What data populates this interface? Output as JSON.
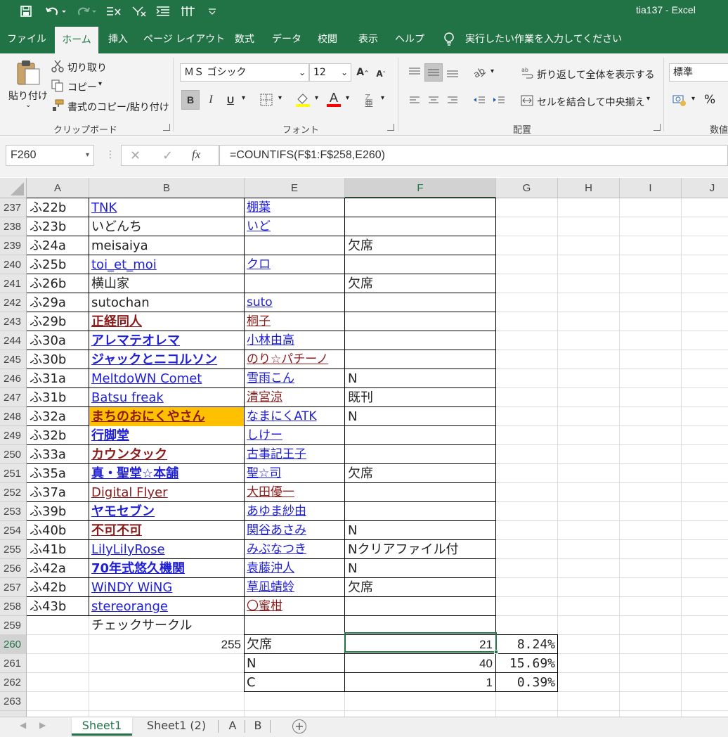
{
  "window": {
    "title": "tia137  -  Excel"
  },
  "ribbon_tabs": [
    "ファイル",
    "ホーム",
    "挿入",
    "ページ レイアウト",
    "数式",
    "データ",
    "校閲",
    "表示",
    "ヘルプ"
  ],
  "tell_me": "実行したい作業を入力してください",
  "clipboard": {
    "paste": "貼り付け",
    "cut": "切り取り",
    "copy": "コピー",
    "format_painter": "書式のコピー/貼り付け",
    "label": "クリップボード"
  },
  "font": {
    "name": "ＭＳ ゴシック",
    "size": "12",
    "label": "フォント",
    "bold": "B",
    "italic": "I",
    "underline": "U",
    "grow": "A",
    "shrink": "A",
    "color_a": "A"
  },
  "alignment": {
    "wrap": "折り返して全体を表示する",
    "merge": "セルを結合して中央揃え",
    "label": "配置"
  },
  "number": {
    "format": "標準",
    "label": "数値",
    "percent": "%"
  },
  "formula_bar": {
    "name_box": "F260",
    "fx": "fx",
    "formula": "=COUNTIFS(F$1:F$258,E260)"
  },
  "columns": [
    "A",
    "B",
    "E",
    "F",
    "G",
    "H",
    "I",
    "J"
  ],
  "rows": [
    {
      "num": "237",
      "a": "ふ22b",
      "b": "TNK",
      "e": "棚葉",
      "f": ""
    },
    {
      "num": "238",
      "a": "ふ23b",
      "b": "いどんち",
      "e": "いど",
      "f": ""
    },
    {
      "num": "239",
      "a": "ふ24a",
      "b": "meisaiya",
      "e": "",
      "f": "欠席"
    },
    {
      "num": "240",
      "a": "ふ25b",
      "b": "toi_et_moi",
      "e": "クロ",
      "f": ""
    },
    {
      "num": "241",
      "a": "ふ26b",
      "b": "横山家",
      "e": "",
      "f": "欠席"
    },
    {
      "num": "242",
      "a": "ふ29a",
      "b": "sutochan",
      "e": "suto",
      "f": ""
    },
    {
      "num": "243",
      "a": "ふ29b",
      "b": "正経同人",
      "e": "桐子",
      "f": ""
    },
    {
      "num": "244",
      "a": "ふ30a",
      "b": "アレマテオレマ",
      "e": "小林由高",
      "f": ""
    },
    {
      "num": "245",
      "a": "ふ30b",
      "b": "ジャックとニコルソン",
      "e": "のり☆パチーノ",
      "f": ""
    },
    {
      "num": "246",
      "a": "ふ31a",
      "b": "MeltdoWN Comet",
      "e": "雪雨こん",
      "f": "N"
    },
    {
      "num": "247",
      "a": "ふ31b",
      "b": "Batsu freak",
      "e": "清宮涼",
      "f": "既刊"
    },
    {
      "num": "248",
      "a": "ふ32a",
      "b": "まちのおにくやさん",
      "e": "なまにくATK",
      "f": "N"
    },
    {
      "num": "249",
      "a": "ふ32b",
      "b": "行脚堂",
      "e": "しけー",
      "f": ""
    },
    {
      "num": "250",
      "a": "ふ33a",
      "b": "カウンタック",
      "e": "古事記王子",
      "f": ""
    },
    {
      "num": "251",
      "a": "ふ35a",
      "b": "真・聖堂☆本舗",
      "e": "聖☆司",
      "f": "欠席"
    },
    {
      "num": "252",
      "a": "ふ37a",
      "b": "Digital Flyer",
      "e": "大田優一",
      "f": ""
    },
    {
      "num": "253",
      "a": "ふ39b",
      "b": "ヤモセブン",
      "e": "あゆま紗由",
      "f": ""
    },
    {
      "num": "254",
      "a": "ふ40b",
      "b": "不可不可",
      "e": "関谷あさみ",
      "f": "N"
    },
    {
      "num": "255",
      "a": "ふ41b",
      "b": "LilyLilyRose",
      "e": "みぶなつき",
      "f": "Nクリアファイル付"
    },
    {
      "num": "256",
      "a": "ふ42a",
      "b": "70年式悠久機関",
      "e": "袁藤沖人",
      "f": "N"
    },
    {
      "num": "257",
      "a": "ふ42b",
      "b": "WiNDY WiNG",
      "e": "草凪蜻蛉",
      "f": "欠席"
    },
    {
      "num": "258",
      "a": "ふ43b",
      "b": "stereorange",
      "e": "〇蜜柑",
      "f": ""
    },
    {
      "num": "259",
      "a": "",
      "b": "チェックサークル",
      "e": "",
      "f": ""
    },
    {
      "num": "260",
      "a": "",
      "b": "255",
      "e": "欠席",
      "f": "21",
      "g": "8.24%"
    },
    {
      "num": "261",
      "a": "",
      "b": "",
      "e": "N",
      "f": "40",
      "g": "15.69%"
    },
    {
      "num": "262",
      "a": "",
      "b": "",
      "e": "C",
      "f": "1",
      "g": "0.39%"
    },
    {
      "num": "263",
      "a": "",
      "b": "",
      "e": "",
      "f": ""
    }
  ],
  "sheet_tabs": [
    "Sheet1",
    "Sheet1 (2)",
    "A",
    "B"
  ],
  "colors": {
    "excel_green": "#217346",
    "link_blue": "#1f1fd8",
    "link_red": "#8b1a1a",
    "highlight": "#ffc000"
  }
}
